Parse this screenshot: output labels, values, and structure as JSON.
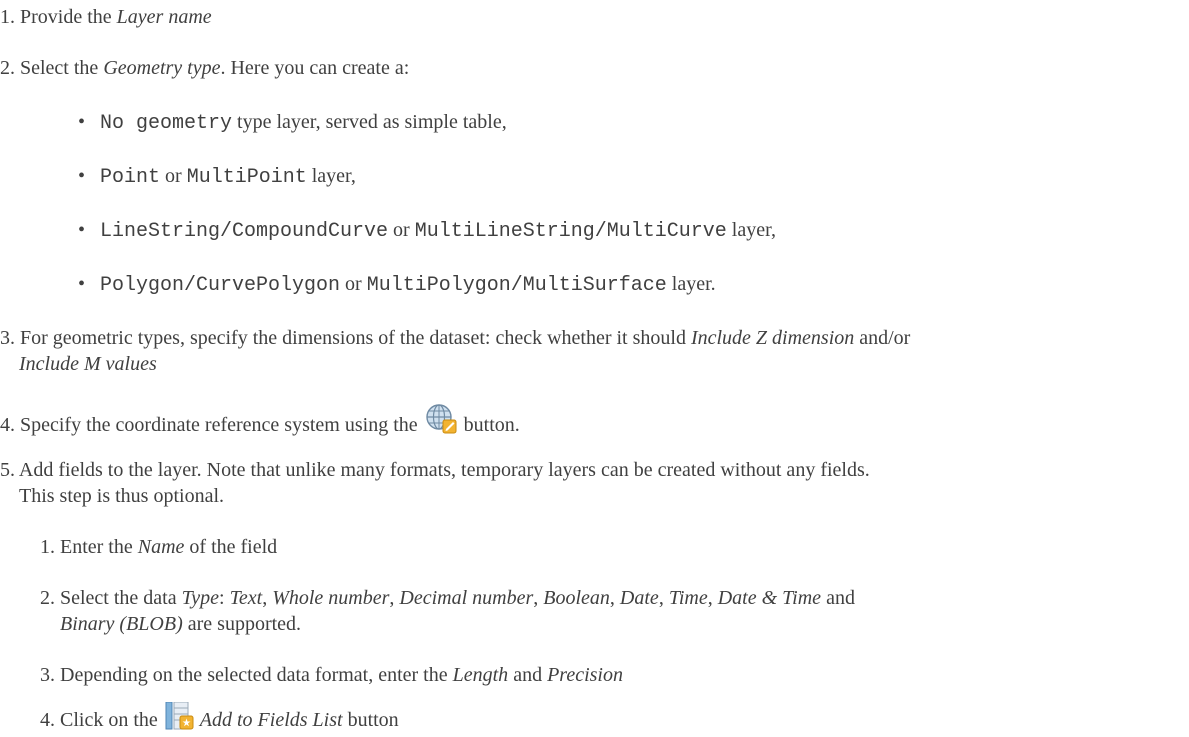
{
  "steps": {
    "s1": {
      "num": "1.",
      "pre": "Provide the ",
      "em": "Layer name"
    },
    "s2": {
      "num": "2.",
      "pre": "Select the ",
      "em": "Geometry type",
      "post": ". Here you can create a:",
      "bullets": [
        {
          "b": "•",
          "c1": "No geometry",
          "t1": " type layer, served as simple table,"
        },
        {
          "b": "•",
          "c1": "Point",
          "t1": " or ",
          "c2": "MultiPoint",
          "t2": " layer,"
        },
        {
          "b": "•",
          "c1": "LineString/CompoundCurve",
          "t1": " or ",
          "c2": "MultiLineString/MultiCurve",
          "t2": " layer,"
        },
        {
          "b": "•",
          "c1": "Polygon/CurvePolygon",
          "t1": " or ",
          "c2": "MultiPolygon/MultiSurface",
          "t2": " layer."
        }
      ]
    },
    "s3": {
      "num": "3.",
      "l1_pre": "For geometric types, specify the dimensions of the dataset: check whether it should ",
      "l1_em": "Include Z dimension",
      "l1_post": " and/or",
      "l2_em": "Include M values"
    },
    "s4": {
      "num": "4.",
      "pre": "Specify the coordinate reference system using the ",
      "post": " button.",
      "icon": "crs-globe-icon"
    },
    "s5": {
      "num": "5.",
      "l1": "Add fields to the layer. Note that unlike many formats, temporary layers can be created without any fields.",
      "l2": "This step is thus optional.",
      "sub": {
        "a": {
          "num": "1.",
          "pre": "Enter the ",
          "em": "Name",
          "post": " of the field"
        },
        "b": {
          "num": "2.",
          "pre": "Select the data ",
          "em_type": "Type",
          "colon": ": ",
          "types": [
            "Text",
            "Whole number",
            "Decimal number",
            "Boolean",
            "Date",
            "Time",
            "Date & Time"
          ],
          "sep": ", ",
          "and": " and ",
          "last": "Binary (BLOB)",
          "post": " are supported."
        },
        "c": {
          "num": "3.",
          "pre": "Depending on the selected data format, enter the ",
          "em1": "Length",
          "mid": " and ",
          "em2": "Precision"
        },
        "d": {
          "num": "4.",
          "pre": "Click on the ",
          "em": "Add to Fields List",
          "post": " button",
          "icon": "add-field-icon"
        }
      }
    }
  }
}
